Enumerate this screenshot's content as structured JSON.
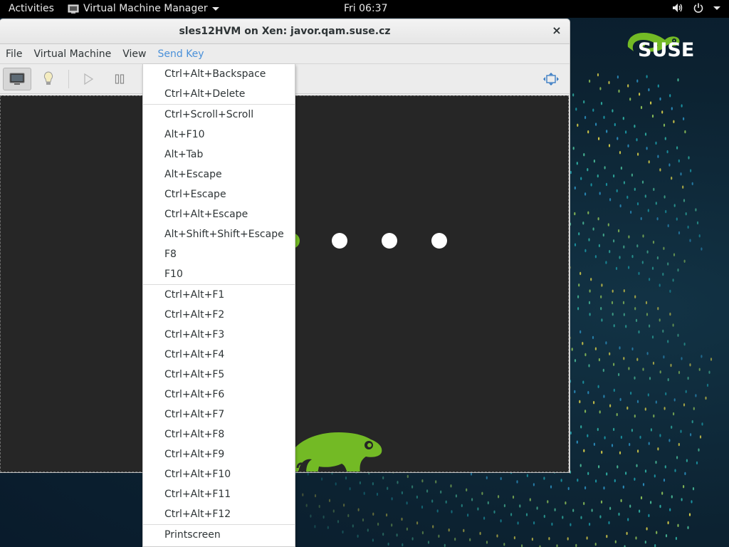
{
  "topbar": {
    "activities": "Activities",
    "app_name": "Virtual Machine Manager",
    "clock": "Fri 06:37",
    "icons": [
      "volume-icon",
      "power-icon",
      "chevron-down-icon"
    ]
  },
  "window": {
    "title": "sles12HVM on Xen: javor.qam.suse.cz",
    "close_glyph": "×",
    "menu": [
      "File",
      "Virtual Machine",
      "View",
      "Send Key"
    ],
    "active_menu": "Send Key",
    "toolbar_icons": [
      "monitor-icon",
      "lightbulb-icon",
      "play-icon",
      "pause-icon",
      "fullscreen-icon"
    ]
  },
  "desktop": {
    "brand": "SUSE",
    "colors": {
      "accent": "#73ba25",
      "background": "#0c2231",
      "menu_highlight": "#4a90d9"
    }
  },
  "sendkey_menu": {
    "groups": [
      [
        "Ctrl+Alt+Backspace",
        "Ctrl+Alt+Delete"
      ],
      [
        "Ctrl+Scroll+Scroll",
        "Alt+F10",
        "Alt+Tab",
        "Alt+Escape",
        "Ctrl+Escape",
        "Ctrl+Alt+Escape",
        "Alt+Shift+Shift+Escape",
        "F8",
        "F10"
      ],
      [
        "Ctrl+Alt+F1",
        "Ctrl+Alt+F2",
        "Ctrl+Alt+F3",
        "Ctrl+Alt+F4",
        "Ctrl+Alt+F5",
        "Ctrl+Alt+F6",
        "Ctrl+Alt+F7",
        "Ctrl+Alt+F8",
        "Ctrl+Alt+F9",
        "Ctrl+Alt+F10",
        "Ctrl+Alt+F11",
        "Ctrl+Alt+F12"
      ],
      [
        "Printscreen"
      ]
    ]
  }
}
